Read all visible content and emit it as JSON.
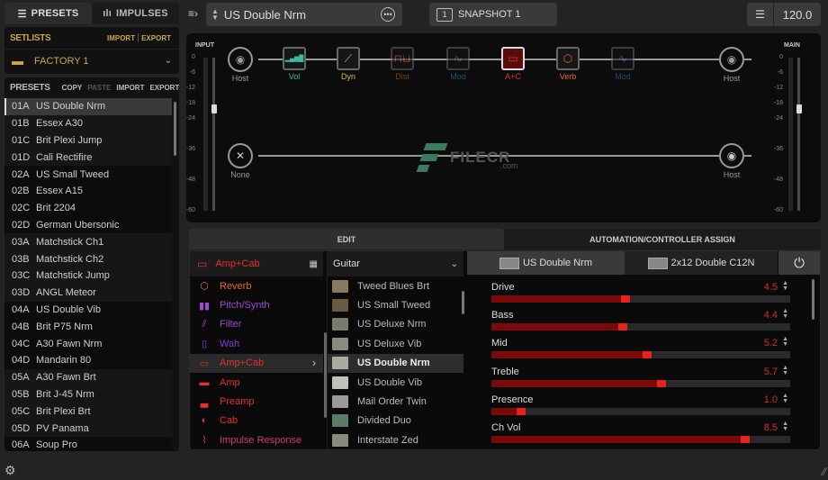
{
  "left_tabs": [
    {
      "label": "PRESETS",
      "icon": "list-icon",
      "active": true
    },
    {
      "label": "IMPULSES",
      "icon": "waveform-icon",
      "active": false
    }
  ],
  "setlists": {
    "title": "SETLISTS",
    "import": "IMPORT",
    "export": "EXPORT",
    "selected": "FACTORY 1"
  },
  "presets": {
    "title": "PRESETS",
    "copy": "COPY",
    "paste": "PASTE",
    "import": "IMPORT",
    "export": "EXPORT",
    "items": [
      {
        "num": "01A",
        "name": "US Double Nrm",
        "selected": true
      },
      {
        "num": "01B",
        "name": "Essex A30"
      },
      {
        "num": "01C",
        "name": "Brit Plexi Jump"
      },
      {
        "num": "01D",
        "name": "Cali Rectifire"
      },
      {
        "num": "02A",
        "name": "US Small Tweed"
      },
      {
        "num": "02B",
        "name": "Essex A15"
      },
      {
        "num": "02C",
        "name": "Brit 2204"
      },
      {
        "num": "02D",
        "name": "German Ubersonic"
      },
      {
        "num": "03A",
        "name": "Matchstick Ch1"
      },
      {
        "num": "03B",
        "name": "Matchstick Ch2"
      },
      {
        "num": "03C",
        "name": "Matchstick Jump"
      },
      {
        "num": "03D",
        "name": "ANGL Meteor"
      },
      {
        "num": "04A",
        "name": "US Double Vib"
      },
      {
        "num": "04B",
        "name": "Brit P75 Nrm"
      },
      {
        "num": "04C",
        "name": "A30 Fawn Nrm"
      },
      {
        "num": "04D",
        "name": "Mandarin 80"
      },
      {
        "num": "05A",
        "name": "A30 Fawn Brt"
      },
      {
        "num": "05B",
        "name": "Brit J-45 Nrm"
      },
      {
        "num": "05C",
        "name": "Brit Plexi Brt"
      },
      {
        "num": "05D",
        "name": "PV Panama"
      },
      {
        "num": "06A",
        "name": "Soup Pro"
      }
    ]
  },
  "topbar": {
    "preset_name": "US Double Nrm",
    "snapshot_number": "1",
    "snapshot_label": "SNAPSHOT 1",
    "tempo": "120.0"
  },
  "signal_path": {
    "input_label": "INPUT",
    "main_label": "MAIN",
    "meter_scale": [
      "0",
      "-6",
      "-12",
      "-18",
      "-24",
      "-36",
      "-48",
      "-60"
    ],
    "input_level_db": -20,
    "main_level_db": -20,
    "path1": [
      {
        "label": "Host",
        "type": "io",
        "color": "#9a9a9a"
      },
      {
        "label": "Vol",
        "type": "block",
        "color": "#3fb8a0"
      },
      {
        "label": "Dyn",
        "type": "block",
        "color": "#d6b84a"
      },
      {
        "label": "Dist",
        "type": "block",
        "color": "#c8703a",
        "bypassed": true
      },
      {
        "label": "Mod",
        "type": "block",
        "color": "#2f86c8",
        "bypassed": true
      },
      {
        "label": "A+C",
        "type": "block",
        "color": "#e0342c",
        "selected": true
      },
      {
        "label": "Verb",
        "type": "block",
        "color": "#e2683a"
      },
      {
        "label": "Mod",
        "type": "block",
        "color": "#2f86c8",
        "bypassed": true
      },
      {
        "label": "Host",
        "type": "io",
        "color": "#9a9a9a"
      }
    ],
    "path2": [
      {
        "label": "None",
        "type": "io"
      },
      {
        "label": "Host",
        "type": "io"
      }
    ],
    "watermark": {
      "text": "FILECR",
      "suffix": ".com"
    }
  },
  "edit_tabs": [
    {
      "label": "EDIT",
      "active": true
    },
    {
      "label": "AUTOMATION/CONTROLLER ASSIGN",
      "active": false
    }
  ],
  "categories": {
    "header": "Amp+Cab",
    "items": [
      {
        "label": "Reverb",
        "color": "#e2683a",
        "icon": "cube-icon"
      },
      {
        "label": "Pitch/Synth",
        "color": "#a04ad0",
        "icon": "keyboard-icon"
      },
      {
        "label": "Filter",
        "color": "#9a4ad0",
        "icon": "filter-icon"
      },
      {
        "label": "Wah",
        "color": "#8a3ad0",
        "icon": "wah-pedal-icon"
      },
      {
        "label": "Amp+Cab",
        "color": "#e0342c",
        "icon": "amp-icon",
        "selected": true
      },
      {
        "label": "Amp",
        "color": "#e0342c",
        "icon": "amp-head-icon"
      },
      {
        "label": "Preamp",
        "color": "#e0342c",
        "icon": "preamp-icon"
      },
      {
        "label": "Cab",
        "color": "#e0342c",
        "icon": "speaker-icon"
      },
      {
        "label": "Impulse Response",
        "color": "#d03a7a",
        "icon": "impulse-icon"
      }
    ]
  },
  "models": {
    "header": "Guitar",
    "items": [
      {
        "label": "Tweed Blues Brt",
        "thumb": "#8a7a60"
      },
      {
        "label": "US Small Tweed",
        "thumb": "#6a5a40"
      },
      {
        "label": "US Deluxe Nrm",
        "thumb": "#7a7a6a"
      },
      {
        "label": "US Deluxe Vib",
        "thumb": "#8a8a80"
      },
      {
        "label": "US Double Nrm",
        "thumb": "#aaaaa0",
        "selected": true
      },
      {
        "label": "US Double Vib",
        "thumb": "#c0c0bc"
      },
      {
        "label": "Mail Order Twin",
        "thumb": "#9a9a9a"
      },
      {
        "label": "Divided Duo",
        "thumb": "#5a7a6a"
      },
      {
        "label": "Interstate Zed",
        "thumb": "#8a8a7a"
      }
    ]
  },
  "params": {
    "amp_tab": "US Double Nrm",
    "cab_tab": "2x12 Double C12N",
    "items": [
      {
        "label": "Drive",
        "value": "4.5",
        "fraction": 0.45
      },
      {
        "label": "Bass",
        "value": "4.4",
        "fraction": 0.44
      },
      {
        "label": "Mid",
        "value": "5.2",
        "fraction": 0.52
      },
      {
        "label": "Treble",
        "value": "5.7",
        "fraction": 0.57
      },
      {
        "label": "Presence",
        "value": "1.0",
        "fraction": 0.1
      },
      {
        "label": "Ch Vol",
        "value": "8.5",
        "fraction": 0.85
      }
    ]
  }
}
